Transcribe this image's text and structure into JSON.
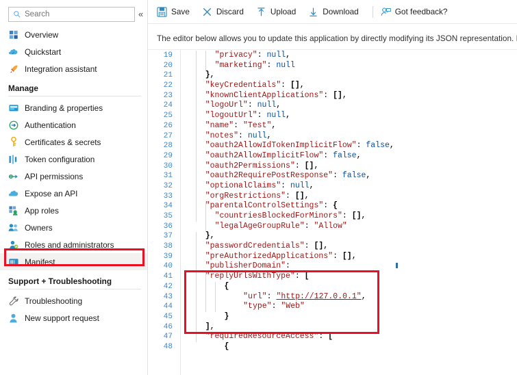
{
  "sidebar": {
    "search": {
      "placeholder": "Search",
      "icon": "search-icon"
    },
    "collapse_label": "«",
    "top_items": [
      {
        "label": "Overview",
        "icon": "overview-grid-icon"
      },
      {
        "label": "Quickstart",
        "icon": "cloud-rocket-icon"
      },
      {
        "label": "Integration assistant",
        "icon": "rocket-icon"
      }
    ],
    "groups": [
      {
        "title": "Manage",
        "items": [
          {
            "label": "Branding & properties",
            "icon": "branding-card-icon"
          },
          {
            "label": "Authentication",
            "icon": "authentication-arrow-icon"
          },
          {
            "label": "Certificates & secrets",
            "icon": "key-icon"
          },
          {
            "label": "Token configuration",
            "icon": "token-bars-icon"
          },
          {
            "label": "API permissions",
            "icon": "api-permissions-icon"
          },
          {
            "label": "Expose an API",
            "icon": "cloud-icon"
          },
          {
            "label": "App roles",
            "icon": "app-roles-icon"
          },
          {
            "label": "Owners",
            "icon": "owners-people-icon"
          },
          {
            "label": "Roles and administrators",
            "icon": "roles-admin-icon"
          },
          {
            "label": "Manifest",
            "icon": "manifest-icon",
            "selected": true,
            "annotated": true
          }
        ]
      },
      {
        "title": "Support + Troubleshooting",
        "items": [
          {
            "label": "Troubleshooting",
            "icon": "wrench-icon"
          },
          {
            "label": "New support request",
            "icon": "support-person-icon"
          }
        ]
      }
    ]
  },
  "toolbar": {
    "commands": [
      {
        "label": "Save",
        "icon": "save-disk-icon"
      },
      {
        "label": "Discard",
        "icon": "discard-x-icon"
      },
      {
        "label": "Upload",
        "icon": "upload-arrow-icon"
      },
      {
        "label": "Download",
        "icon": "download-arrow-icon"
      }
    ],
    "feedback": {
      "label": "Got feedback?",
      "icon": "feedback-person-icon"
    }
  },
  "description": "The editor below allows you to update this application by directly modifying its JSON representation. For more details, se",
  "editor": {
    "first_line_number": 19,
    "lines": [
      {
        "n": 19,
        "indent": 3,
        "tokens": [
          {
            "t": "k",
            "v": "\"privacy\""
          },
          {
            "t": "p",
            "v": ": "
          },
          {
            "t": "kw",
            "v": "null"
          },
          {
            "t": "p",
            "v": ","
          }
        ]
      },
      {
        "n": 20,
        "indent": 3,
        "tokens": [
          {
            "t": "k",
            "v": "\"marketing\""
          },
          {
            "t": "p",
            "v": ": "
          },
          {
            "t": "kw",
            "v": "null"
          }
        ]
      },
      {
        "n": 21,
        "indent": 2,
        "tokens": [
          {
            "t": "br",
            "v": "}"
          },
          {
            "t": "p",
            "v": ","
          }
        ]
      },
      {
        "n": 22,
        "indent": 2,
        "tokens": [
          {
            "t": "k",
            "v": "\"keyCredentials\""
          },
          {
            "t": "p",
            "v": ": "
          },
          {
            "t": "br",
            "v": "[]"
          },
          {
            "t": "p",
            "v": ","
          }
        ]
      },
      {
        "n": 23,
        "indent": 2,
        "tokens": [
          {
            "t": "k",
            "v": "\"knownClientApplications\""
          },
          {
            "t": "p",
            "v": ": "
          },
          {
            "t": "br",
            "v": "[]"
          },
          {
            "t": "p",
            "v": ","
          }
        ]
      },
      {
        "n": 24,
        "indent": 2,
        "tokens": [
          {
            "t": "k",
            "v": "\"logoUrl\""
          },
          {
            "t": "p",
            "v": ": "
          },
          {
            "t": "kw",
            "v": "null"
          },
          {
            "t": "p",
            "v": ","
          }
        ]
      },
      {
        "n": 25,
        "indent": 2,
        "tokens": [
          {
            "t": "k",
            "v": "\"logoutUrl\""
          },
          {
            "t": "p",
            "v": ": "
          },
          {
            "t": "kw",
            "v": "null"
          },
          {
            "t": "p",
            "v": ","
          }
        ]
      },
      {
        "n": 26,
        "indent": 2,
        "tokens": [
          {
            "t": "k",
            "v": "\"name\""
          },
          {
            "t": "p",
            "v": ": "
          },
          {
            "t": "s",
            "v": "\"Test\""
          },
          {
            "t": "p",
            "v": ","
          }
        ]
      },
      {
        "n": 27,
        "indent": 2,
        "tokens": [
          {
            "t": "k",
            "v": "\"notes\""
          },
          {
            "t": "p",
            "v": ": "
          },
          {
            "t": "kw",
            "v": "null"
          },
          {
            "t": "p",
            "v": ","
          }
        ]
      },
      {
        "n": 28,
        "indent": 2,
        "tokens": [
          {
            "t": "k",
            "v": "\"oauth2AllowIdTokenImplicitFlow\""
          },
          {
            "t": "p",
            "v": ": "
          },
          {
            "t": "kw",
            "v": "false"
          },
          {
            "t": "p",
            "v": ","
          }
        ]
      },
      {
        "n": 29,
        "indent": 2,
        "tokens": [
          {
            "t": "k",
            "v": "\"oauth2AllowImplicitFlow\""
          },
          {
            "t": "p",
            "v": ": "
          },
          {
            "t": "kw",
            "v": "false"
          },
          {
            "t": "p",
            "v": ","
          }
        ]
      },
      {
        "n": 30,
        "indent": 2,
        "tokens": [
          {
            "t": "k",
            "v": "\"oauth2Permissions\""
          },
          {
            "t": "p",
            "v": ": "
          },
          {
            "t": "br",
            "v": "[]"
          },
          {
            "t": "p",
            "v": ","
          }
        ]
      },
      {
        "n": 31,
        "indent": 2,
        "tokens": [
          {
            "t": "k",
            "v": "\"oauth2RequirePostResponse\""
          },
          {
            "t": "p",
            "v": ": "
          },
          {
            "t": "kw",
            "v": "false"
          },
          {
            "t": "p",
            "v": ","
          }
        ]
      },
      {
        "n": 32,
        "indent": 2,
        "tokens": [
          {
            "t": "k",
            "v": "\"optionalClaims\""
          },
          {
            "t": "p",
            "v": ": "
          },
          {
            "t": "kw",
            "v": "null"
          },
          {
            "t": "p",
            "v": ","
          }
        ]
      },
      {
        "n": 33,
        "indent": 2,
        "tokens": [
          {
            "t": "k",
            "v": "\"orgRestrictions\""
          },
          {
            "t": "p",
            "v": ": "
          },
          {
            "t": "br",
            "v": "[]"
          },
          {
            "t": "p",
            "v": ","
          }
        ]
      },
      {
        "n": 34,
        "indent": 2,
        "tokens": [
          {
            "t": "k",
            "v": "\"parentalControlSettings\""
          },
          {
            "t": "p",
            "v": ": "
          },
          {
            "t": "br",
            "v": "{"
          }
        ]
      },
      {
        "n": 35,
        "indent": 3,
        "tokens": [
          {
            "t": "k",
            "v": "\"countriesBlockedForMinors\""
          },
          {
            "t": "p",
            "v": ": "
          },
          {
            "t": "br",
            "v": "[]"
          },
          {
            "t": "p",
            "v": ","
          }
        ]
      },
      {
        "n": 36,
        "indent": 3,
        "tokens": [
          {
            "t": "k",
            "v": "\"legalAgeGroupRule\""
          },
          {
            "t": "p",
            "v": ": "
          },
          {
            "t": "s",
            "v": "\"Allow\""
          }
        ]
      },
      {
        "n": 37,
        "indent": 2,
        "tokens": [
          {
            "t": "br",
            "v": "}"
          },
          {
            "t": "p",
            "v": ","
          }
        ]
      },
      {
        "n": 38,
        "indent": 2,
        "tokens": [
          {
            "t": "k",
            "v": "\"passwordCredentials\""
          },
          {
            "t": "p",
            "v": ": "
          },
          {
            "t": "br",
            "v": "[]"
          },
          {
            "t": "p",
            "v": ","
          }
        ]
      },
      {
        "n": 39,
        "indent": 2,
        "tokens": [
          {
            "t": "k",
            "v": "\"preAuthorizedApplications\""
          },
          {
            "t": "p",
            "v": ": "
          },
          {
            "t": "br",
            "v": "[]"
          },
          {
            "t": "p",
            "v": ","
          }
        ]
      },
      {
        "n": 40,
        "indent": 2,
        "tokens": [
          {
            "t": "k",
            "v": "\"publisherDomain\""
          },
          {
            "t": "p",
            "v": ":"
          }
        ],
        "error": true
      },
      {
        "n": 41,
        "indent": 2,
        "tokens": [
          {
            "t": "k",
            "v": "\"replyUrlsWithType\""
          },
          {
            "t": "p",
            "v": ": "
          },
          {
            "t": "br",
            "v": "["
          }
        ]
      },
      {
        "n": 42,
        "indent": 4,
        "tokens": [
          {
            "t": "br",
            "v": "{"
          }
        ]
      },
      {
        "n": 43,
        "indent": 6,
        "tokens": [
          {
            "t": "k",
            "v": "\"url\""
          },
          {
            "t": "p",
            "v": ": "
          },
          {
            "t": "lnk",
            "v": "\"http://127.0.0.1\""
          },
          {
            "t": "p",
            "v": ","
          }
        ]
      },
      {
        "n": 44,
        "indent": 6,
        "tokens": [
          {
            "t": "k",
            "v": "\"type\""
          },
          {
            "t": "p",
            "v": ": "
          },
          {
            "t": "s",
            "v": "\"Web\""
          }
        ]
      },
      {
        "n": 45,
        "indent": 4,
        "tokens": [
          {
            "t": "br",
            "v": "}"
          }
        ]
      },
      {
        "n": 46,
        "indent": 2,
        "tokens": [
          {
            "t": "br",
            "v": "]"
          },
          {
            "t": "p",
            "v": ","
          }
        ]
      },
      {
        "n": 47,
        "indent": 2,
        "tokens": [
          {
            "t": "k",
            "v": "\"requiredResourceAccess\""
          },
          {
            "t": "p",
            "v": ": "
          },
          {
            "t": "br",
            "v": "["
          }
        ]
      },
      {
        "n": 48,
        "indent": 4,
        "tokens": [
          {
            "t": "br",
            "v": "{"
          }
        ]
      }
    ],
    "annotation": {
      "from_line": 41,
      "to_line": 46,
      "color": "#e81123"
    }
  },
  "colors": {
    "annotation_red": "#e81123",
    "json_key": "#a31515",
    "json_keyword": "#0451a5",
    "line_number": "#3d85c6",
    "selected_row": "#f3f2f1"
  }
}
